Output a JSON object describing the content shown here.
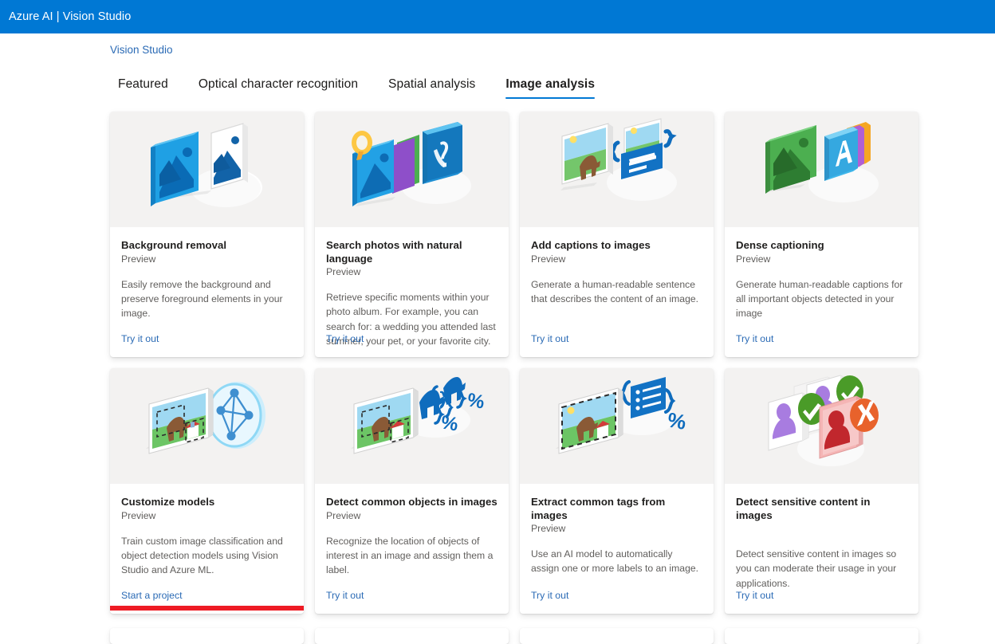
{
  "header": {
    "title": "Azure AI  |  Vision Studio",
    "brand_color": "#0078d4"
  },
  "breadcrumb": {
    "label": "Vision Studio"
  },
  "tabs": [
    {
      "label": "Featured",
      "active": false
    },
    {
      "label": "Optical character recognition",
      "active": false
    },
    {
      "label": "Spatial analysis",
      "active": false
    },
    {
      "label": "Image analysis",
      "active": true
    }
  ],
  "highlight": {
    "color": "#ee1b24",
    "target_card": "Customize models"
  },
  "cards": [
    {
      "title": "Background removal",
      "preview": "Preview",
      "description": "Easily remove the background and preserve foreground elements in your image.",
      "link": "Try it out",
      "icon": "two-photos-blue-icon"
    },
    {
      "title": "Search photos with natural language",
      "preview": "Preview",
      "description": "Retrieve specific moments within your photo album. For example, you can search for: a wedding you attended last summer, your pet, or your favorite city.",
      "link": "Try it out",
      "icon": "photo-stack-magnifier-icon"
    },
    {
      "title": "Add captions to images",
      "preview": "Preview",
      "description": "Generate a human-readable sentence that describes the content of an image.",
      "link": "Try it out",
      "icon": "photo-caption-braces-icon"
    },
    {
      "title": "Dense captioning",
      "preview": "Preview",
      "description": "Generate human-readable captions for all important objects detected in your image",
      "link": "Try it out",
      "icon": "green-photo-letter-a-icon"
    },
    {
      "title": "Customize models",
      "preview": "Preview",
      "description": "Train custom image classification and object detection models using Vision Studio and Azure ML.",
      "link": "Start a project",
      "icon": "photo-neural-network-icon"
    },
    {
      "title": "Detect common objects in images",
      "preview": "Preview",
      "description": "Recognize the location of objects of interest in an image and assign them a label.",
      "link": "Try it out",
      "icon": "object-detection-braces-percent-icon"
    },
    {
      "title": "Extract common tags from images",
      "preview": "Preview",
      "description": "Use an AI model to automatically assign one or more labels to an image.",
      "link": "Try it out",
      "icon": "tag-list-braces-percent-icon"
    },
    {
      "title": "Detect sensitive content in images",
      "preview": "",
      "description": "Detect sensitive content in images so you can moderate their usage in your applications.",
      "link": "Try it out",
      "icon": "moderation-check-cross-icon"
    }
  ]
}
